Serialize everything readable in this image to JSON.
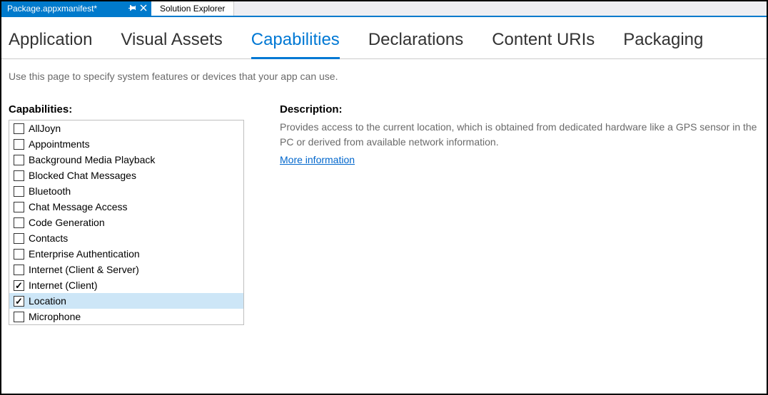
{
  "doc_tabs": {
    "active": "Package.appxmanifest*",
    "other": "Solution Explorer"
  },
  "nav_tabs": [
    {
      "label": "Application",
      "active": false
    },
    {
      "label": "Visual Assets",
      "active": false
    },
    {
      "label": "Capabilities",
      "active": true
    },
    {
      "label": "Declarations",
      "active": false
    },
    {
      "label": "Content URIs",
      "active": false
    },
    {
      "label": "Packaging",
      "active": false
    }
  ],
  "help_text": "Use this page to specify system features or devices that your app can use.",
  "capabilities_title": "Capabilities:",
  "capabilities": [
    {
      "label": "AllJoyn",
      "checked": false,
      "selected": false
    },
    {
      "label": "Appointments",
      "checked": false,
      "selected": false
    },
    {
      "label": "Background Media Playback",
      "checked": false,
      "selected": false
    },
    {
      "label": "Blocked Chat Messages",
      "checked": false,
      "selected": false
    },
    {
      "label": "Bluetooth",
      "checked": false,
      "selected": false
    },
    {
      "label": "Chat Message Access",
      "checked": false,
      "selected": false
    },
    {
      "label": "Code Generation",
      "checked": false,
      "selected": false
    },
    {
      "label": "Contacts",
      "checked": false,
      "selected": false
    },
    {
      "label": "Enterprise Authentication",
      "checked": false,
      "selected": false
    },
    {
      "label": "Internet (Client & Server)",
      "checked": false,
      "selected": false
    },
    {
      "label": "Internet (Client)",
      "checked": true,
      "selected": false
    },
    {
      "label": "Location",
      "checked": true,
      "selected": true
    },
    {
      "label": "Microphone",
      "checked": false,
      "selected": false
    }
  ],
  "description_title": "Description:",
  "description_text": "Provides access to the current location, which is obtained from dedicated hardware like a GPS sensor in the PC or derived from available network information.",
  "more_info": "More information"
}
